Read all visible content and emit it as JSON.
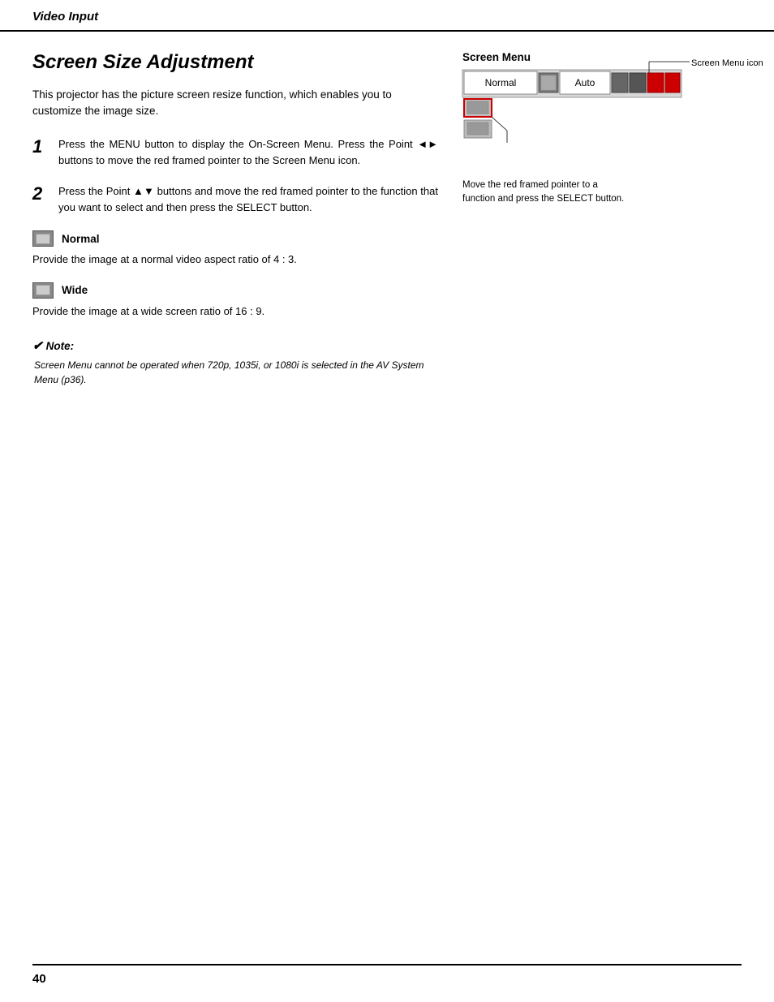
{
  "header": {
    "title": "Video Input"
  },
  "page": {
    "title": "Screen Size Adjustment",
    "page_number": "40",
    "intro": "This projector has the picture screen resize function, which enables you to customize the image size."
  },
  "steps": [
    {
      "number": "1",
      "text": "Press the MENU button to display the On-Screen Menu.  Press the Point ◄► buttons to move the red framed pointer to the Screen Menu icon."
    },
    {
      "number": "2",
      "text": "Press the Point ▲▼ buttons and move the red framed pointer to the function that you want to select and then press the SELECT button."
    }
  ],
  "sections": [
    {
      "id": "normal",
      "label": "Normal",
      "desc": "Provide the image at a normal video aspect ratio of 4 : 3."
    },
    {
      "id": "wide",
      "label": "Wide",
      "desc": "Provide the image at a wide screen ratio of 16 : 9."
    }
  ],
  "note": {
    "title": "Note:",
    "text": "Screen Menu cannot be operated when 720p, 1035i, or 1080i is selected in the AV System Menu (p36)."
  },
  "screen_menu": {
    "label": "Screen Menu",
    "normal_btn": "Normal",
    "auto_btn": "Auto",
    "icon_label": "Screen Menu icon",
    "annotation": "Move the red framed pointer to a function and press the SELECT button."
  }
}
